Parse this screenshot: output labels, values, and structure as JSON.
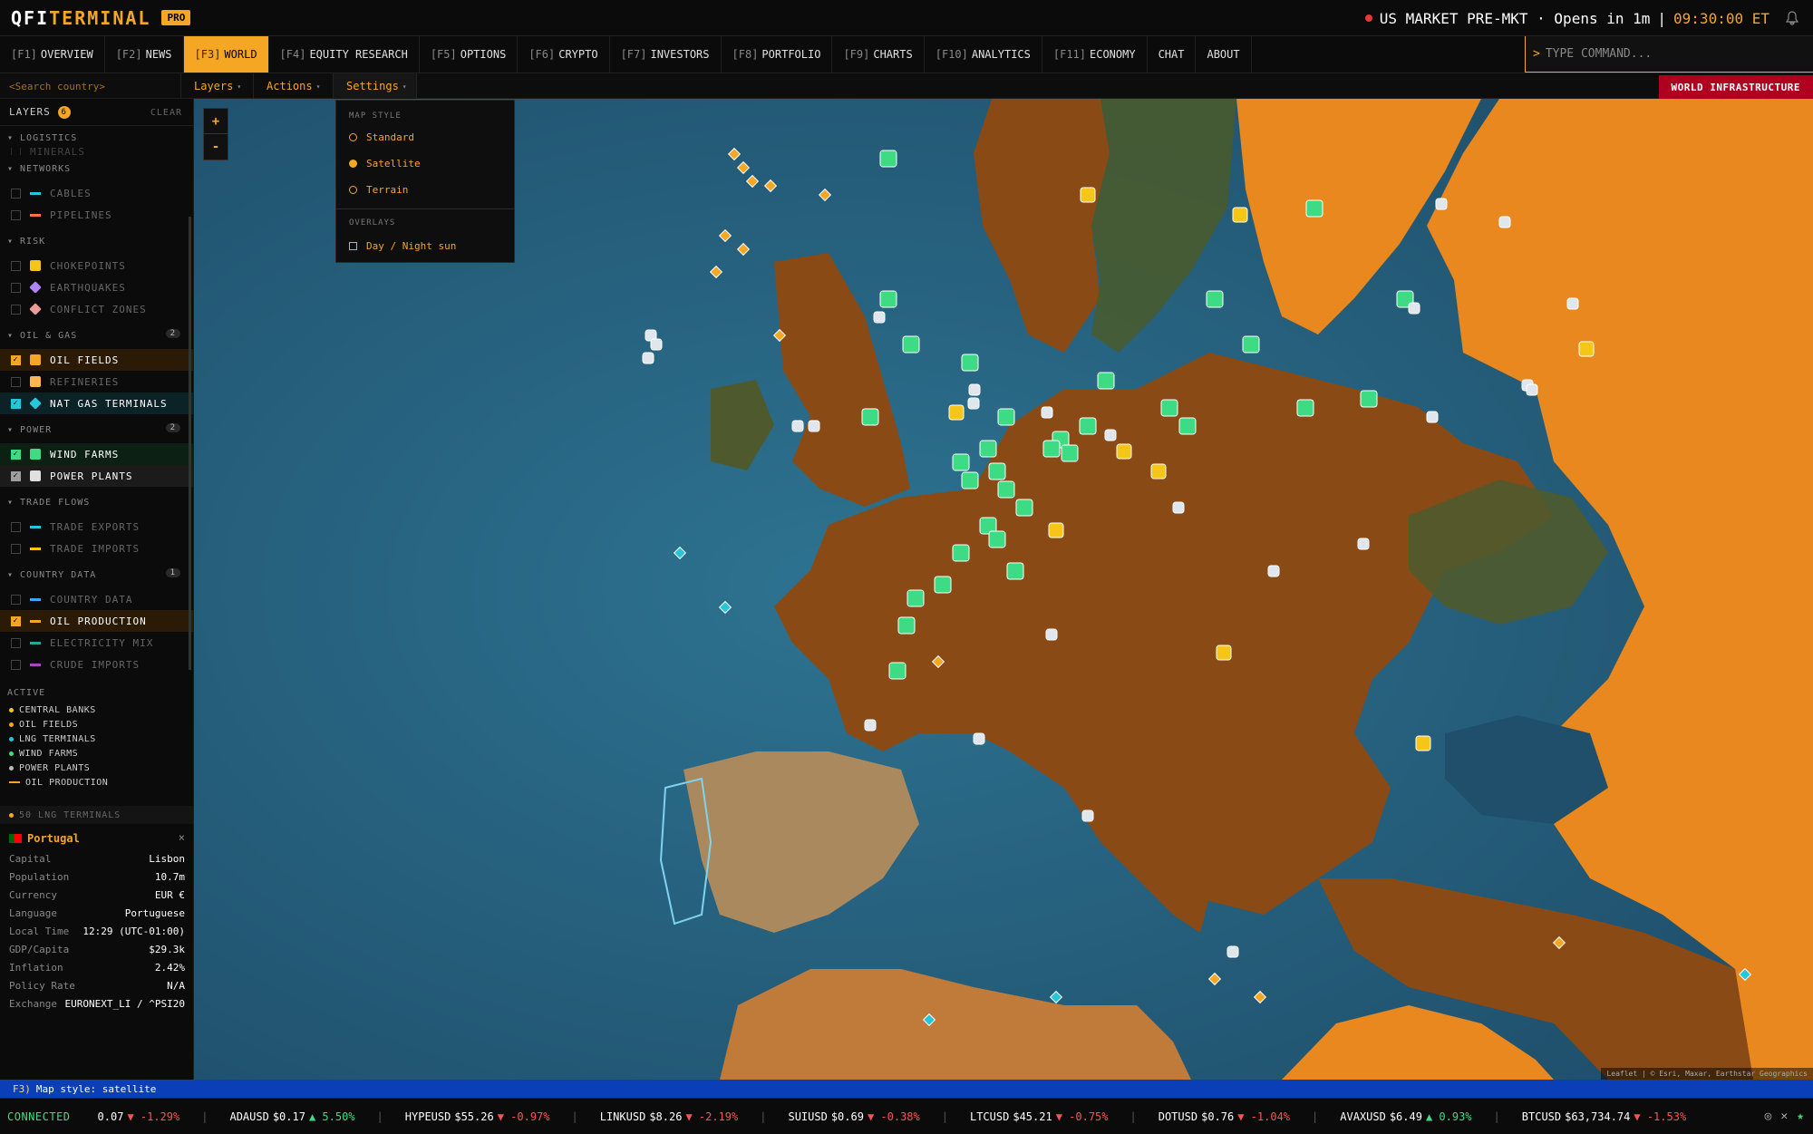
{
  "header": {
    "logo_a": "QFI",
    "logo_b": "TERMINAL",
    "pro": "PRO",
    "market_status": "US MARKET PRE-MKT · Opens in 1m",
    "divider": "|",
    "time": "09:30:00 ET"
  },
  "nav": [
    {
      "key": "[F1]",
      "label": "OVERVIEW"
    },
    {
      "key": "[F2]",
      "label": "NEWS"
    },
    {
      "key": "[F3]",
      "label": "WORLD",
      "active": true
    },
    {
      "key": "[F4]",
      "label": "EQUITY RESEARCH"
    },
    {
      "key": "[F5]",
      "label": "OPTIONS"
    },
    {
      "key": "[F6]",
      "label": "CRYPTO"
    },
    {
      "key": "[F7]",
      "label": "INVESTORS"
    },
    {
      "key": "[F8]",
      "label": "PORTFOLIO"
    },
    {
      "key": "[F9]",
      "label": "CHARTS"
    },
    {
      "key": "[F10]",
      "label": "ANALYTICS"
    },
    {
      "key": "[F11]",
      "label": "ECONOMY"
    },
    {
      "key": "",
      "label": "CHAT"
    },
    {
      "key": "",
      "label": "ABOUT"
    }
  ],
  "command": {
    "prompt": ">",
    "placeholder": "TYPE COMMAND..."
  },
  "subbar": {
    "search_placeholder": "<Search country>",
    "layers": "Layers",
    "actions": "Actions",
    "settings": "Settings",
    "caret": "▾",
    "world_infra": "WORLD INFRASTRUCTURE"
  },
  "sidebar": {
    "title": "LAYERS",
    "count": "6",
    "clear": "CLEAR",
    "groups": {
      "logistics": "▾ LOGISTICS",
      "minerals": "MINERALS",
      "networks": "▾ NETWORKS",
      "cables": "CABLES",
      "pipelines": "PIPELINES",
      "risk": "▾ RISK",
      "chokepoints": "CHOKEPOINTS",
      "earthquakes": "EARTHQUAKES",
      "conflict": "CONFLICT ZONES",
      "oilgas": "▾ OIL & GAS",
      "oilgas_count": "2",
      "oil_fields": "OIL FIELDS",
      "refineries": "REFINERIES",
      "nat_gas": "NAT GAS TERMINALS",
      "power": "▾ POWER",
      "power_count": "2",
      "wind": "WIND FARMS",
      "plants": "POWER PLANTS",
      "trade": "▾ TRADE FLOWS",
      "exports": "TRADE EXPORTS",
      "imports": "TRADE IMPORTS",
      "countrydata": "▾ COUNTRY DATA",
      "countrydata_count": "1",
      "cdata": "COUNTRY DATA",
      "oilprod": "OIL PRODUCTION",
      "elecmix": "ELECTRICITY MIX",
      "crude": "CRUDE IMPORTS"
    },
    "active_title": "ACTIVE",
    "active": [
      {
        "label": "CENTRAL BANKS",
        "color": "#f5c518"
      },
      {
        "label": "OIL FIELDS",
        "color": "#f5a623"
      },
      {
        "label": "LNG TERMINALS",
        "color": "#26c6da"
      },
      {
        "label": "WIND FARMS",
        "color": "#3ddc84"
      },
      {
        "label": "POWER PLANTS",
        "color": "#bdbdbd"
      },
      {
        "label": "OIL PRODUCTION",
        "color": "#f5a623"
      }
    ],
    "lng_count": "50 LNG TERMINALS"
  },
  "country": {
    "name": "Portugal",
    "close": "×",
    "rows": [
      {
        "label": "Capital",
        "value": "Lisbon"
      },
      {
        "label": "Population",
        "value": "10.7m"
      },
      {
        "label": "Currency",
        "value": "EUR €"
      },
      {
        "label": "Language",
        "value": "Portuguese"
      },
      {
        "label": "Local Time",
        "value": "12:29 (UTC-01:00)"
      },
      {
        "label": "GDP/Capita",
        "value": "$29.3k"
      },
      {
        "label": "Inflation",
        "value": "2.42%"
      },
      {
        "label": "Policy Rate",
        "value": "N/A"
      },
      {
        "label": "Exchange",
        "value": "EURONEXT_LI / ^PSI20"
      }
    ]
  },
  "map": {
    "zoom_in": "+",
    "zoom_out": "-",
    "attribution": "Leaflet | © Esri, Maxar, Earthstar Geographics"
  },
  "settings_menu": {
    "map_style_title": "MAP STYLE",
    "standard": "Standard",
    "satellite": "Satellite",
    "terrain": "Terrain",
    "overlays_title": "OVERLAYS",
    "daynight": "Day / Night sun"
  },
  "status": {
    "key": "F3)",
    "text": "Map style: satellite"
  },
  "ticker": {
    "connected": "CONNECTED",
    "items": [
      {
        "sym": "",
        "price": "0.07",
        "chg": "▼ -1.29%",
        "dir": "dn"
      },
      {
        "sym": "ADAUSD",
        "price": "$0.17",
        "chg": "▲ 5.50%",
        "dir": "up"
      },
      {
        "sym": "HYPEUSD",
        "price": "$55.26",
        "chg": "▼ -0.97%",
        "dir": "dn"
      },
      {
        "sym": "LINKUSD",
        "price": "$8.26",
        "chg": "▼ -2.19%",
        "dir": "dn"
      },
      {
        "sym": "SUIUSD",
        "price": "$0.69",
        "chg": "▼ -0.38%",
        "dir": "dn"
      },
      {
        "sym": "LTCUSD",
        "price": "$45.21",
        "chg": "▼ -0.75%",
        "dir": "dn"
      },
      {
        "sym": "DOTUSD",
        "price": "$0.76",
        "chg": "▼ -1.04%",
        "dir": "dn"
      },
      {
        "sym": "AVAXUSD",
        "price": "$6.49",
        "chg": "▲ 0.93%",
        "dir": "up"
      },
      {
        "sym": "BTCUSD",
        "price": "$63,734.74",
        "chg": "▼ -1.53%",
        "dir": "dn"
      }
    ]
  }
}
